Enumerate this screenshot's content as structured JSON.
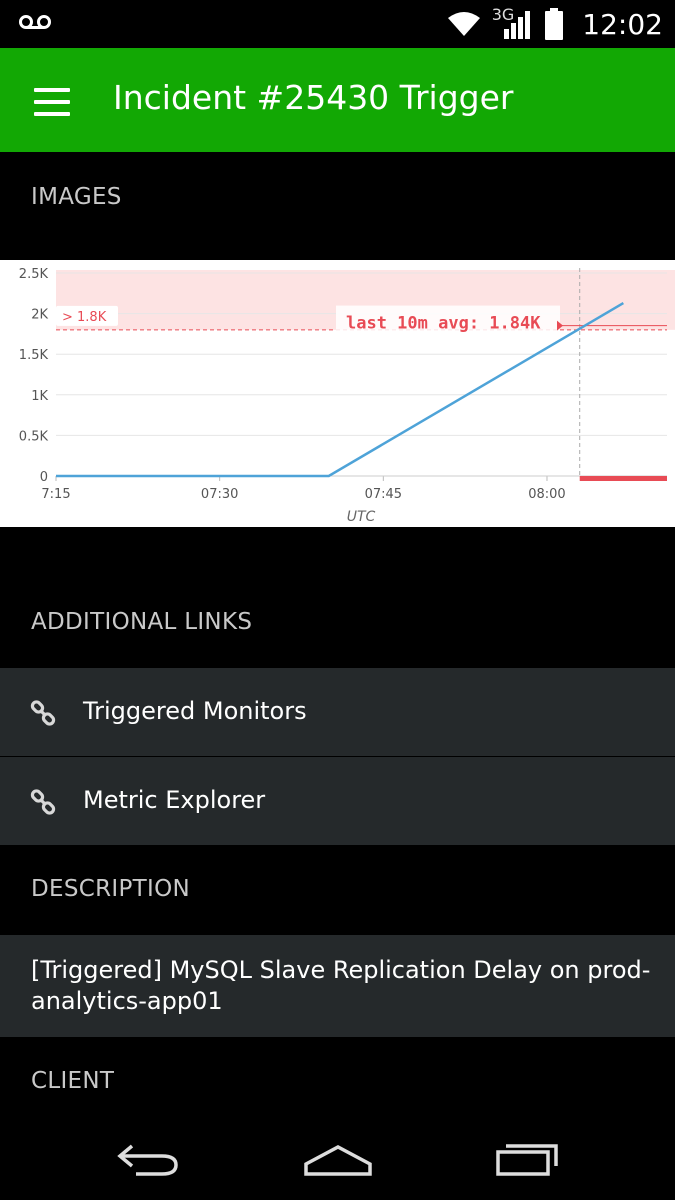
{
  "status_bar": {
    "time": "12:02",
    "network": "3G",
    "icons": [
      "voicemail-icon",
      "wifi-icon",
      "signal-icon",
      "battery-icon"
    ]
  },
  "app_bar": {
    "title": "Incident #25430 Trigger",
    "menu_icon": "hamburger-menu-icon",
    "background": "#12a804"
  },
  "sections": {
    "images": "IMAGES",
    "additional_links": "ADDITIONAL LINKS",
    "description": "DESCRIPTION",
    "client": "CLIENT"
  },
  "links": [
    {
      "label": "Triggered Monitors",
      "icon": "link-icon"
    },
    {
      "label": "Metric Explorer",
      "icon": "link-icon"
    }
  ],
  "description_text": "[Triggered] MySQL Slave Replication Delay on prod-analytics-app01",
  "nav_bar": {
    "icons": [
      "back-icon",
      "home-icon",
      "recents-icon"
    ]
  },
  "chart_data": {
    "type": "line",
    "x": [
      "07:15",
      "07:40",
      "08:07"
    ],
    "series": [
      {
        "values": [
          0,
          0,
          2130
        ]
      }
    ],
    "x_ticks": [
      "7:15",
      "07:30",
      "07:45",
      "08:00"
    ],
    "y_ticks": [
      "0",
      "0.5K",
      "1K",
      "1.5K",
      "2K",
      "2.5K"
    ],
    "ylim": [
      0,
      2500
    ],
    "xlabel": "UTC",
    "threshold": {
      "value": 1800,
      "label": "> 1.8K"
    },
    "annotation": "last 10m avg: 1.84K",
    "marker_time": "08:03",
    "grid": true,
    "colors": {
      "line": "#4ea3d8",
      "threshold": "#e84b55",
      "alert_band": "#fde3e3"
    }
  }
}
